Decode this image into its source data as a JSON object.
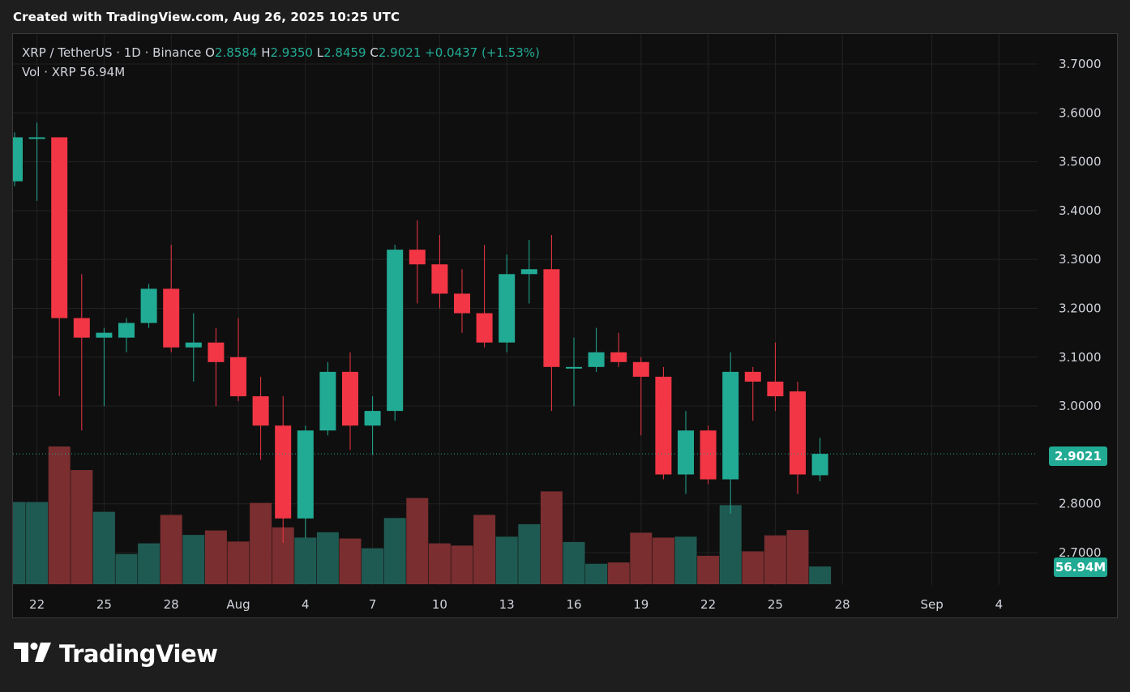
{
  "caption": "Created with TradingView.com, Aug 26, 2025 10:25 UTC",
  "brand": {
    "name": "TradingView",
    "logo_icon": "tradingview-logo-icon"
  },
  "legend": {
    "symbol": "XRP / TetherUS · 1D · Binance",
    "o_label": "O",
    "o_value": "2.8584",
    "h_label": "H",
    "h_value": "2.9350",
    "l_label": "L",
    "l_value": "2.8459",
    "c_label": "C",
    "c_value": "2.9021",
    "change": "+0.0437 (+1.53%)",
    "vol_label": "Vol · XRP",
    "vol_value": "56.94M"
  },
  "price_tag": "2.9021",
  "vol_tag": "56.94M",
  "colors": {
    "up": "#22ab94",
    "down": "#f23645",
    "vol_up": "#1f5a52",
    "vol_down": "#7a2e2f",
    "grid": "#222222",
    "background": "#0f0f0f"
  },
  "chart_data": {
    "type": "candlestick",
    "title": "XRP / TetherUS · 1D · Binance",
    "ylim": [
      2.64,
      3.76
    ],
    "yticks": [
      "3.7000",
      "3.6000",
      "3.5000",
      "3.4000",
      "3.3000",
      "3.2000",
      "3.1000",
      "3.0000",
      "2.8000",
      "2.7000"
    ],
    "yticks_values": [
      3.7,
      3.6,
      3.5,
      3.4,
      3.3,
      3.2,
      3.1,
      3.0,
      2.8,
      2.7
    ],
    "xticks": [
      "22",
      "25",
      "28",
      "Aug",
      "4",
      "7",
      "10",
      "13",
      "16",
      "19",
      "22",
      "25",
      "28",
      "Sep",
      "4"
    ],
    "xticks_day_index": [
      1,
      4,
      7,
      10,
      13,
      16,
      19,
      22,
      25,
      28,
      31,
      34,
      37,
      41,
      44
    ],
    "last_price": 2.9021,
    "volume_max_m": 310,
    "candles": [
      {
        "date": "2025-07-21",
        "o": 3.46,
        "h": 3.56,
        "l": 3.45,
        "c": 3.55,
        "vol_m": 185
      },
      {
        "date": "2025-07-22",
        "o": 3.55,
        "h": 3.58,
        "l": 3.42,
        "c": 3.55,
        "vol_m": 185
      },
      {
        "date": "2025-07-23",
        "o": 3.55,
        "h": 3.55,
        "l": 3.02,
        "c": 3.18,
        "vol_m": 310
      },
      {
        "date": "2025-07-24",
        "o": 3.18,
        "h": 3.27,
        "l": 2.95,
        "c": 3.14,
        "vol_m": 257
      },
      {
        "date": "2025-07-25",
        "o": 3.14,
        "h": 3.16,
        "l": 3.0,
        "c": 3.15,
        "vol_m": 163
      },
      {
        "date": "2025-07-26",
        "o": 3.14,
        "h": 3.18,
        "l": 3.11,
        "c": 3.17,
        "vol_m": 68
      },
      {
        "date": "2025-07-27",
        "o": 3.17,
        "h": 3.25,
        "l": 3.16,
        "c": 3.24,
        "vol_m": 92
      },
      {
        "date": "2025-07-28",
        "o": 3.24,
        "h": 3.33,
        "l": 3.11,
        "c": 3.12,
        "vol_m": 156
      },
      {
        "date": "2025-07-29",
        "o": 3.12,
        "h": 3.19,
        "l": 3.05,
        "c": 3.13,
        "vol_m": 111
      },
      {
        "date": "2025-07-30",
        "o": 3.13,
        "h": 3.16,
        "l": 3.0,
        "c": 3.09,
        "vol_m": 121
      },
      {
        "date": "2025-07-31",
        "o": 3.1,
        "h": 3.18,
        "l": 3.01,
        "c": 3.02,
        "vol_m": 96
      },
      {
        "date": "2025-08-01",
        "o": 3.02,
        "h": 3.06,
        "l": 2.89,
        "c": 2.96,
        "vol_m": 183
      },
      {
        "date": "2025-08-02",
        "o": 2.96,
        "h": 3.02,
        "l": 2.72,
        "c": 2.77,
        "vol_m": 128
      },
      {
        "date": "2025-08-03",
        "o": 2.77,
        "h": 2.96,
        "l": 2.73,
        "c": 2.95,
        "vol_m": 105
      },
      {
        "date": "2025-08-04",
        "o": 2.95,
        "h": 3.09,
        "l": 2.94,
        "c": 3.07,
        "vol_m": 117
      },
      {
        "date": "2025-08-05",
        "o": 3.07,
        "h": 3.11,
        "l": 2.91,
        "c": 2.96,
        "vol_m": 103
      },
      {
        "date": "2025-08-06",
        "o": 2.96,
        "h": 3.02,
        "l": 2.9,
        "c": 2.99,
        "vol_m": 81
      },
      {
        "date": "2025-08-07",
        "o": 2.99,
        "h": 3.33,
        "l": 2.97,
        "c": 3.32,
        "vol_m": 149
      },
      {
        "date": "2025-08-08",
        "o": 3.32,
        "h": 3.38,
        "l": 3.21,
        "c": 3.29,
        "vol_m": 194
      },
      {
        "date": "2025-08-09",
        "o": 3.29,
        "h": 3.35,
        "l": 3.2,
        "c": 3.23,
        "vol_m": 92
      },
      {
        "date": "2025-08-10",
        "o": 3.23,
        "h": 3.28,
        "l": 3.15,
        "c": 3.19,
        "vol_m": 87
      },
      {
        "date": "2025-08-11",
        "o": 3.19,
        "h": 3.33,
        "l": 3.12,
        "c": 3.13,
        "vol_m": 156
      },
      {
        "date": "2025-08-12",
        "o": 3.13,
        "h": 3.31,
        "l": 3.11,
        "c": 3.27,
        "vol_m": 107
      },
      {
        "date": "2025-08-13",
        "o": 3.27,
        "h": 3.34,
        "l": 3.21,
        "c": 3.28,
        "vol_m": 135
      },
      {
        "date": "2025-08-14",
        "o": 3.28,
        "h": 3.35,
        "l": 2.99,
        "c": 3.08,
        "vol_m": 209
      },
      {
        "date": "2025-08-15",
        "o": 3.08,
        "h": 3.14,
        "l": 3.0,
        "c": 3.08,
        "vol_m": 95
      },
      {
        "date": "2025-08-16",
        "o": 3.08,
        "h": 3.16,
        "l": 3.07,
        "c": 3.11,
        "vol_m": 46
      },
      {
        "date": "2025-08-17",
        "o": 3.11,
        "h": 3.15,
        "l": 3.08,
        "c": 3.09,
        "vol_m": 49
      },
      {
        "date": "2025-08-18",
        "o": 3.09,
        "h": 3.1,
        "l": 2.94,
        "c": 3.06,
        "vol_m": 116
      },
      {
        "date": "2025-08-19",
        "o": 3.06,
        "h": 3.08,
        "l": 2.85,
        "c": 2.86,
        "vol_m": 105
      },
      {
        "date": "2025-08-20",
        "o": 2.86,
        "h": 2.99,
        "l": 2.82,
        "c": 2.95,
        "vol_m": 107
      },
      {
        "date": "2025-08-21",
        "o": 2.95,
        "h": 2.96,
        "l": 2.84,
        "c": 2.85,
        "vol_m": 64
      },
      {
        "date": "2025-08-22",
        "o": 2.85,
        "h": 3.11,
        "l": 2.78,
        "c": 3.07,
        "vol_m": 178
      },
      {
        "date": "2025-08-23",
        "o": 3.07,
        "h": 3.08,
        "l": 2.97,
        "c": 3.05,
        "vol_m": 74
      },
      {
        "date": "2025-08-24",
        "o": 3.05,
        "h": 3.13,
        "l": 2.99,
        "c": 3.02,
        "vol_m": 110
      },
      {
        "date": "2025-08-25",
        "o": 3.03,
        "h": 3.05,
        "l": 2.82,
        "c": 2.86,
        "vol_m": 122
      },
      {
        "date": "2025-08-26",
        "o": 2.8584,
        "h": 2.935,
        "l": 2.8459,
        "c": 2.9021,
        "vol_m": 40
      }
    ]
  }
}
